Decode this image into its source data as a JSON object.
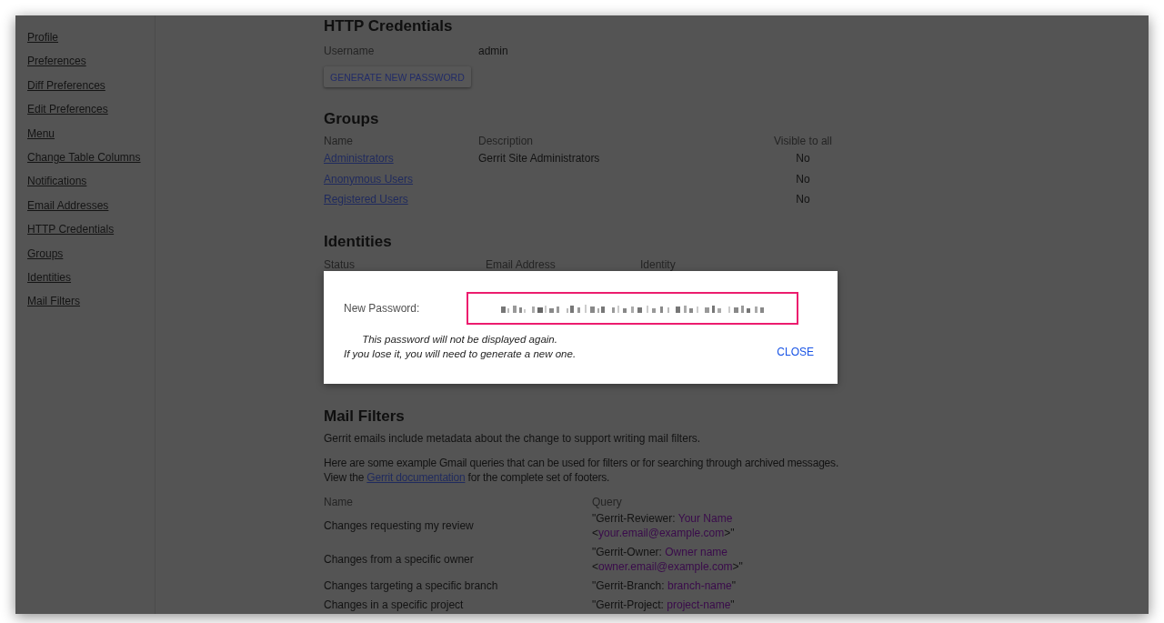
{
  "sidebar": {
    "items": [
      "Profile",
      "Preferences",
      "Diff Preferences",
      "Edit Preferences",
      "Menu",
      "Change Table Columns",
      "Notifications",
      "Email Addresses",
      "HTTP Credentials",
      "Groups",
      "Identities",
      "Mail Filters"
    ]
  },
  "http_credentials": {
    "title": "HTTP Credentials",
    "username_label": "Username",
    "username": "admin",
    "generate_button": "GENERATE NEW PASSWORD"
  },
  "groups": {
    "title": "Groups",
    "columns": [
      "Name",
      "Description",
      "Visible to all"
    ],
    "rows": [
      {
        "name": "Administrators",
        "description": "Gerrit Site Administrators",
        "visible_to_all": "No"
      },
      {
        "name": "Anonymous Users",
        "visible_to_all": "No"
      },
      {
        "name": "Registered Users",
        "visible_to_all": "No"
      }
    ]
  },
  "identities": {
    "title": "Identities",
    "columns": [
      "Status",
      "Email Address",
      "Identity"
    ]
  },
  "dialog": {
    "label": "New Password:",
    "notice": [
      "This password will not be displayed again.",
      "If you lose it, you will need to generate a new one."
    ],
    "close_button": "CLOSE"
  },
  "mail_filters": {
    "title": "Mail Filters",
    "intro": "Gerrit emails include metadata about the change to support writing mail filters.",
    "paragraph": {
      "before": "Here are some example Gmail queries that can be used for filters or for searching through archived messages. View the",
      "link": "Gerrit documentation",
      "after": "for the complete set of footers."
    },
    "columns": [
      "Name",
      "Query"
    ],
    "rows": [
      {
        "name": "Changes requesting my review",
        "query": [
          {
            "kind": "plain",
            "text": "\"Gerrit-Reviewer: "
          },
          {
            "kind": "placeholder",
            "text": "Your Name"
          },
          {
            "kind": "plain",
            "text": " <"
          },
          {
            "kind": "placeholder",
            "text": "your.email@example.com"
          },
          {
            "kind": "plain",
            "text": ">\""
          }
        ]
      },
      {
        "name": "Changes from a specific owner",
        "query": [
          {
            "kind": "plain",
            "text": "\"Gerrit-Owner: "
          },
          {
            "kind": "placeholder",
            "text": "Owner name"
          },
          {
            "kind": "plain",
            "text": " <"
          },
          {
            "kind": "placeholder",
            "text": "owner.email@example.com"
          },
          {
            "kind": "plain",
            "text": ">\""
          }
        ]
      },
      {
        "name": "Changes targeting a specific branch",
        "query": [
          {
            "kind": "plain",
            "text": "\"Gerrit-Branch: "
          },
          {
            "kind": "placeholder",
            "text": "branch-name"
          },
          {
            "kind": "plain",
            "text": "\""
          }
        ]
      },
      {
        "name": "Changes in a specific project",
        "query": [
          {
            "kind": "plain",
            "text": "\"Gerrit-Project: "
          },
          {
            "kind": "placeholder",
            "text": "project-name"
          },
          {
            "kind": "plain",
            "text": "\""
          }
        ]
      }
    ]
  }
}
